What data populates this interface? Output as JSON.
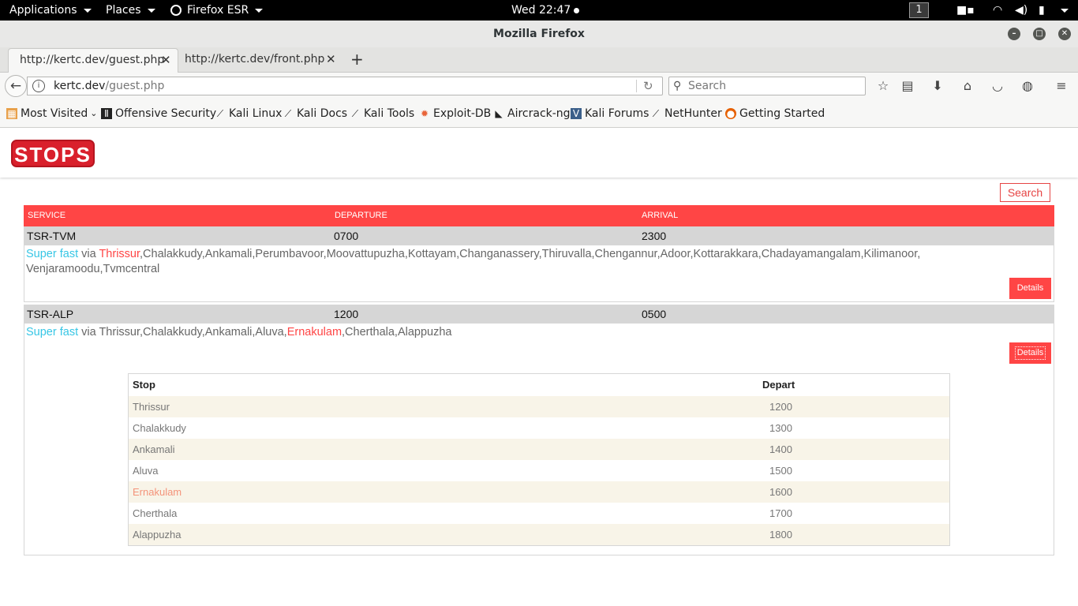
{
  "system_bar": {
    "applications": "Applications",
    "places": "Places",
    "firefox_menu": "Firefox ESR",
    "clock": "Wed 22:47",
    "workspace": "1"
  },
  "window": {
    "title": "Mozilla Firefox"
  },
  "tabs": [
    {
      "label": "http://kertc.dev/guest.php",
      "active": true
    },
    {
      "label": "http://kertc.dev/front.php",
      "active": false
    }
  ],
  "navbar": {
    "url_host": "kertc.dev",
    "url_path": "/guest.php",
    "search_placeholder": "Search"
  },
  "bookmarks": [
    {
      "label": "Most Visited",
      "icon": "most-visited-icon"
    },
    {
      "label": "Offensive Security",
      "icon": "offsec-icon"
    },
    {
      "label": "Kali Linux",
      "icon": "kali-icon"
    },
    {
      "label": "Kali Docs",
      "icon": "kali-icon"
    },
    {
      "label": "Kali Tools",
      "icon": "kali-icon"
    },
    {
      "label": "Exploit-DB",
      "icon": "exploitdb-icon"
    },
    {
      "label": "Aircrack-ng",
      "icon": "aircrack-icon"
    },
    {
      "label": "Kali Forums",
      "icon": "kali-forums-icon"
    },
    {
      "label": "NetHunter",
      "icon": "kali-icon"
    },
    {
      "label": "Getting Started",
      "icon": "firefox-icon"
    }
  ],
  "page": {
    "logo_text": "STOPS",
    "search_button": "Search",
    "columns": [
      "SERVICE",
      "DEPARTURE",
      "ARRIVAL"
    ],
    "services": [
      {
        "service": "TSR-TVM",
        "departure": "0700",
        "arrival": "2300",
        "type": "Super fast",
        "via_word": " via ",
        "first_stop": "Thrissur",
        "rest_line1": ",Chalakkudy,Ankamali,Perumbavoor,Moovattupuzha,Kottayam,Changanassery,Thiruvalla,Chengannur,Adoor,Kottarakkara,Chadayamangalam,Kilimanoor,",
        "rest_line2": "Venjaramoodu,Tvmcentral",
        "details": "Details"
      },
      {
        "service": "TSR-ALP",
        "departure": "1200",
        "arrival": "0500",
        "type": "Super fast",
        "via_word": " via ",
        "before_hl": "Thrissur,Chalakkudy,Ankamali,Aluva,",
        "hl_stop": "Ernakulam",
        "after_hl": ",Cherthala,Alappuzha",
        "details": "Details"
      }
    ],
    "stops_table": {
      "headers": [
        "Stop",
        "Depart"
      ],
      "rows": [
        {
          "stop": "Thrissur",
          "depart": "1200"
        },
        {
          "stop": "Chalakkudy",
          "depart": "1300"
        },
        {
          "stop": "Ankamali",
          "depart": "1400"
        },
        {
          "stop": "Aluva",
          "depart": "1500"
        },
        {
          "stop": "Ernakulam",
          "depart": "1600"
        },
        {
          "stop": "Cherthala",
          "depart": "1700"
        },
        {
          "stop": "Alappuzha",
          "depart": "1800"
        }
      ]
    }
  },
  "colors": {
    "accent": "#ff4545",
    "service_type": "#37c6e5",
    "row_gray": "#d6d6d6",
    "stripe": "#f8f4e8"
  }
}
